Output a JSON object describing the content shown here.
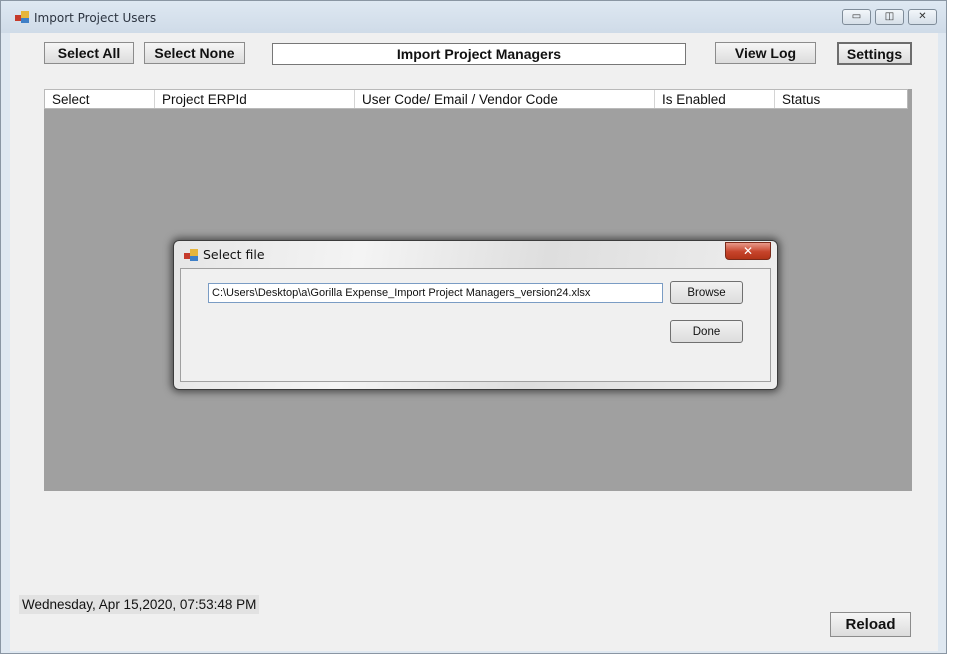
{
  "window": {
    "title": "Import Project Users",
    "controls": {
      "minimize": "▭",
      "maximize": "◫",
      "close": "✕"
    }
  },
  "toolbar": {
    "select_all": "Select All",
    "select_none": "Select None",
    "import_label": "Import Project Managers",
    "view_log": "View Log",
    "settings": "Settings"
  },
  "grid": {
    "columns": [
      "Select",
      "Project ERPId",
      "User Code/ Email / Vendor Code",
      "Is Enabled",
      "Status"
    ]
  },
  "status": {
    "datetime": "Wednesday, Apr 15,2020, 07:53:48 PM"
  },
  "footer": {
    "reload": "Reload"
  },
  "dialog": {
    "title": "Select file",
    "close": "✕",
    "file_path": "C:\\Users\\Desktop\\a\\Gorilla Expense_Import Project Managers_version24.xlsx",
    "browse": "Browse",
    "done": "Done"
  },
  "colors": {
    "grid_bg": "#a0a0a0",
    "close_red": "#c6432b",
    "window_frame": "#dfe8f1"
  }
}
